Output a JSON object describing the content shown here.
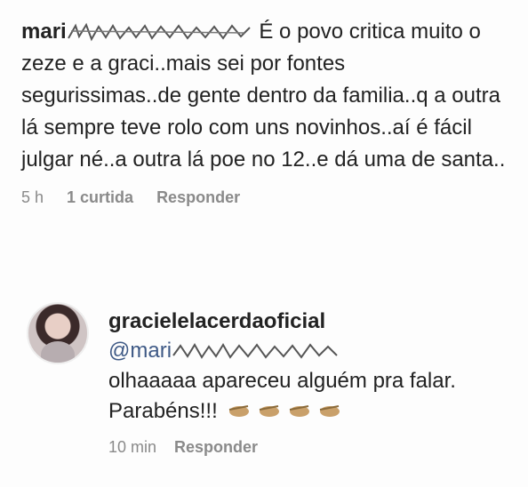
{
  "comment": {
    "username_visible": "mari",
    "text": "É o povo critica muito o zeze e a graci..mais sei por fontes segurissimas..de gente dentro da familia..q a outra lá sempre teve rolo com uns novinhos..aí é fácil julgar né..a outra lá poe no 12..e dá uma de santa..",
    "time": "5 h",
    "likes": "1 curtida",
    "reply_label": "Responder"
  },
  "reply": {
    "username": "gracielelacerdaoficial",
    "mention_visible": "@mari",
    "text": "olhaaaaa apareceu alguém pra falar. Parabéns!!!",
    "emoji_count": 4,
    "emoji_icon": "clapping-hands-icon",
    "time": "10 min",
    "reply_label": "Responder"
  },
  "colors": {
    "meta_gray": "#8a8a8a",
    "mention_blue": "#3f5a86"
  }
}
